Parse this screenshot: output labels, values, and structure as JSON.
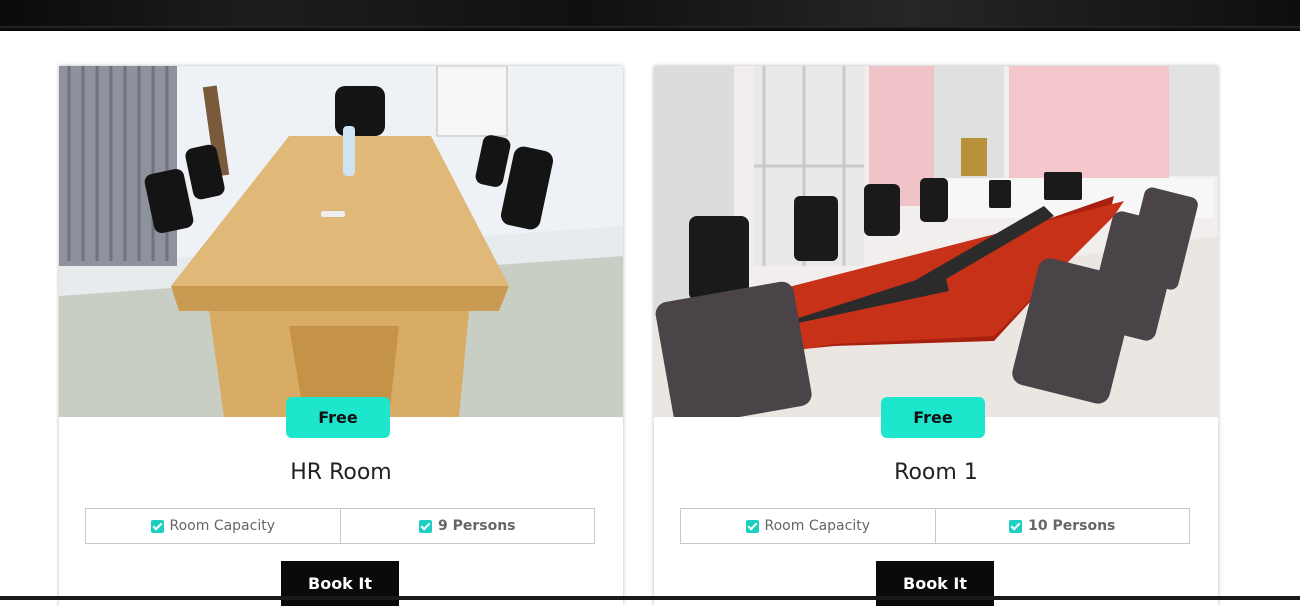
{
  "rooms": [
    {
      "status": "Free",
      "name": "HR Room",
      "capacity_label": "Room Capacity",
      "capacity_value": "9 Persons",
      "book_label": "Book It",
      "image_icon": "meeting-room-photo"
    },
    {
      "status": "Free",
      "name": "Room 1",
      "capacity_label": "Room Capacity",
      "capacity_value": "10 Persons",
      "book_label": "Book It",
      "image_icon": "conference-room-photo"
    }
  ],
  "colors": {
    "badge": "#1de6cd",
    "check": "#1dcfc0",
    "button": "#0a0a0a"
  }
}
